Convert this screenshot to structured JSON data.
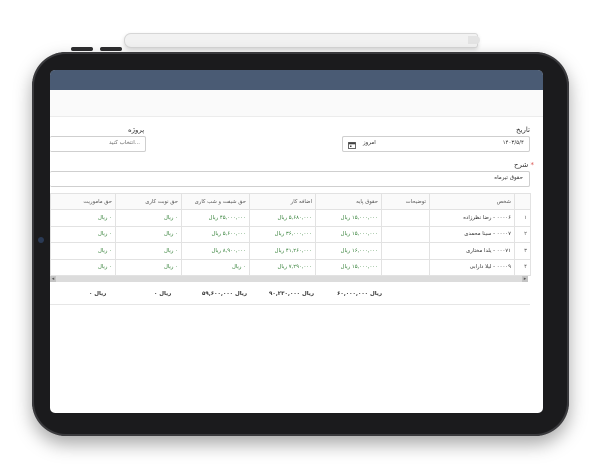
{
  "form": {
    "date_label": "تاریخ",
    "date_value": "۱۴۰۳/۵/۴",
    "project_label": "پروژه",
    "project_placeholder": "انتخاب کنید...",
    "today_label": "امروز",
    "description_label": "شرح",
    "required_mark": "*",
    "description_value": "حقوق تیرماه"
  },
  "table": {
    "columns": [
      "شخص",
      "توضیحات",
      "حقوق پایه",
      "اضافه کار",
      "حق شیفت و شب کاری",
      "حق نوبت کاری",
      "حق ماموریت"
    ],
    "rows": [
      {
        "index": "۱",
        "person": "۰۰۰۰۶ - رضا نظرزاده",
        "desc": "",
        "base": "۱۵,۰۰۰,۰۰۰ ریال",
        "overtime": "۵,۶۸۰,۰۰۰ ریال",
        "shift": "۴۵,۰۰۰,۰۰۰ ریال",
        "turn": "۰ ریال",
        "mission": "۰ ریال"
      },
      {
        "index": "۲",
        "person": "۰۰۰۰۷ - سینا محمدی",
        "desc": "",
        "base": "۱۵,۰۰۰,۰۰۰ ریال",
        "overtime": "۳۶,۰۰۰,۰۰۰ ریال",
        "shift": "۵,۶۰۰,۰۰۰ ریال",
        "turn": "۰ ریال",
        "mission": "۰ ریال"
      },
      {
        "index": "۳",
        "person": "۰۰۰۷۱ - یلدا مختاری",
        "desc": "",
        "base": "۱۶,۰۰۰,۰۰۰ ریال",
        "overtime": "۴۱,۲۶۰,۰۰۰ ریال",
        "shift": "۸,۹۰۰,۰۰۰ ریال",
        "turn": "۰ ریال",
        "mission": "۰ ریال"
      },
      {
        "index": "۴",
        "person": "۰۰۰۰۹ - لیلا دارابی",
        "desc": "",
        "base": "۱۵,۰۰۰,۰۰۰ ریال",
        "overtime": "۷,۲۹۰,۰۰۰ ریال",
        "shift": "۰ ریال",
        "turn": "۰ ریال",
        "mission": "۰ ریال"
      }
    ],
    "totals": {
      "base": "۶۰,۰۰۰,۰۰۰ ریال",
      "overtime": "۹۰,۲۳۰,۰۰۰ ریال",
      "shift": "۵۹,۶۰۰,۰۰۰ ریال",
      "turn": "۰ ریال",
      "mission": "۰ ریال"
    }
  },
  "colors": {
    "header_bar": "#4a5b74",
    "money_green": "#2e7d32",
    "required_red": "#d9534f"
  }
}
